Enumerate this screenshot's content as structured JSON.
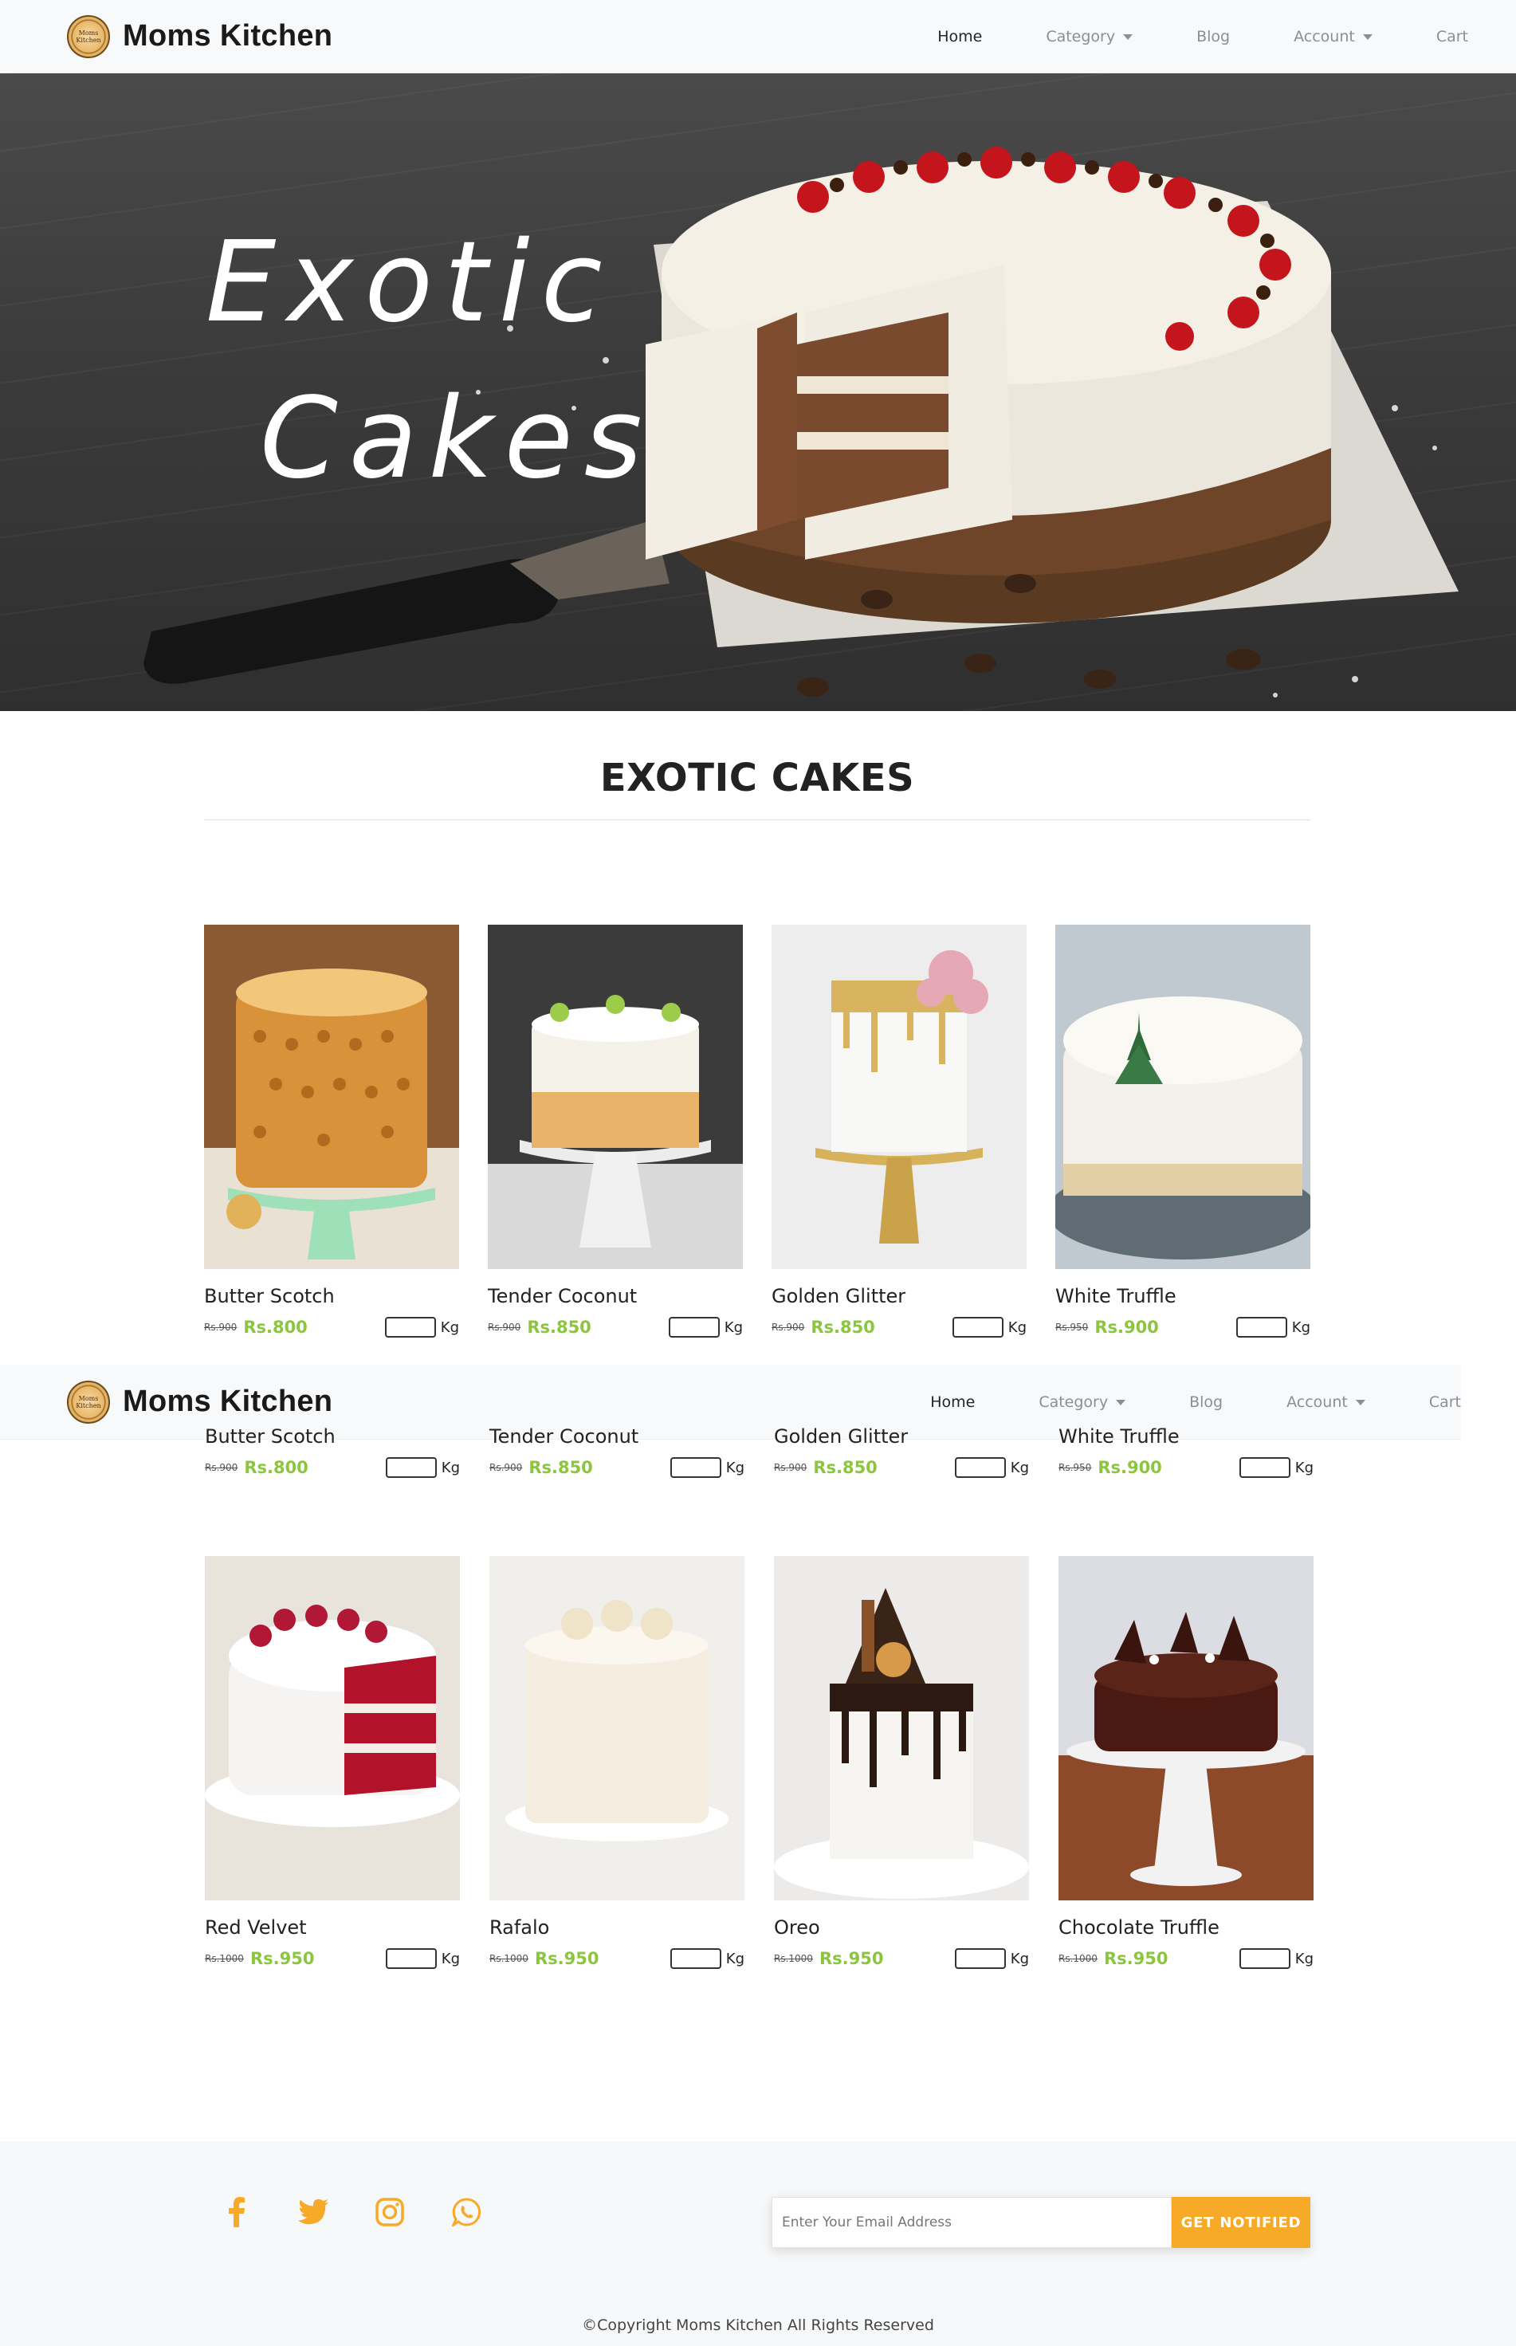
{
  "brand": {
    "name": "Moms Kitchen",
    "logo_text": "Moms Kitchen"
  },
  "nav": {
    "items": [
      {
        "label": "Home",
        "dropdown": false
      },
      {
        "label": "Category",
        "dropdown": true
      },
      {
        "label": "Blog",
        "dropdown": false
      },
      {
        "label": "Account",
        "dropdown": true
      },
      {
        "label": "Cart",
        "dropdown": false
      }
    ]
  },
  "hero": {
    "line1": "Exotic",
    "line2": "Cakes"
  },
  "section": {
    "title": "EXOTIC CAKES"
  },
  "qty_unit": "Kg",
  "products": [
    {
      "name": "Butter Scotch",
      "old_price": "Rs.900",
      "price": "Rs.800"
    },
    {
      "name": "Tender Coconut",
      "old_price": "Rs.900",
      "price": "Rs.850"
    },
    {
      "name": "Golden Glitter",
      "old_price": "Rs.900",
      "price": "Rs.850"
    },
    {
      "name": "White Truffle",
      "old_price": "Rs.950",
      "price": "Rs.900"
    },
    {
      "name": "Red Velvet",
      "old_price": "Rs.1000",
      "price": "Rs.950"
    },
    {
      "name": "Rafalo",
      "old_price": "Rs.1000",
      "price": "Rs.950"
    },
    {
      "name": "Oreo",
      "old_price": "Rs.1000",
      "price": "Rs.950"
    },
    {
      "name": "Chocolate Truffle",
      "old_price": "Rs.1000",
      "price": "Rs.950"
    }
  ],
  "footer": {
    "social": [
      "facebook-icon",
      "twitter-icon",
      "instagram-icon",
      "whatsapp-icon"
    ],
    "email_placeholder": "Enter Your Email Address",
    "button_label": "GET NOTIFIED",
    "copyright": "©Copyright Moms Kitchen All Rights Reserved"
  },
  "colors": {
    "accent": "#f7a928",
    "price_green": "#8cc63f",
    "navbar_bg": "#f8f9fa"
  }
}
